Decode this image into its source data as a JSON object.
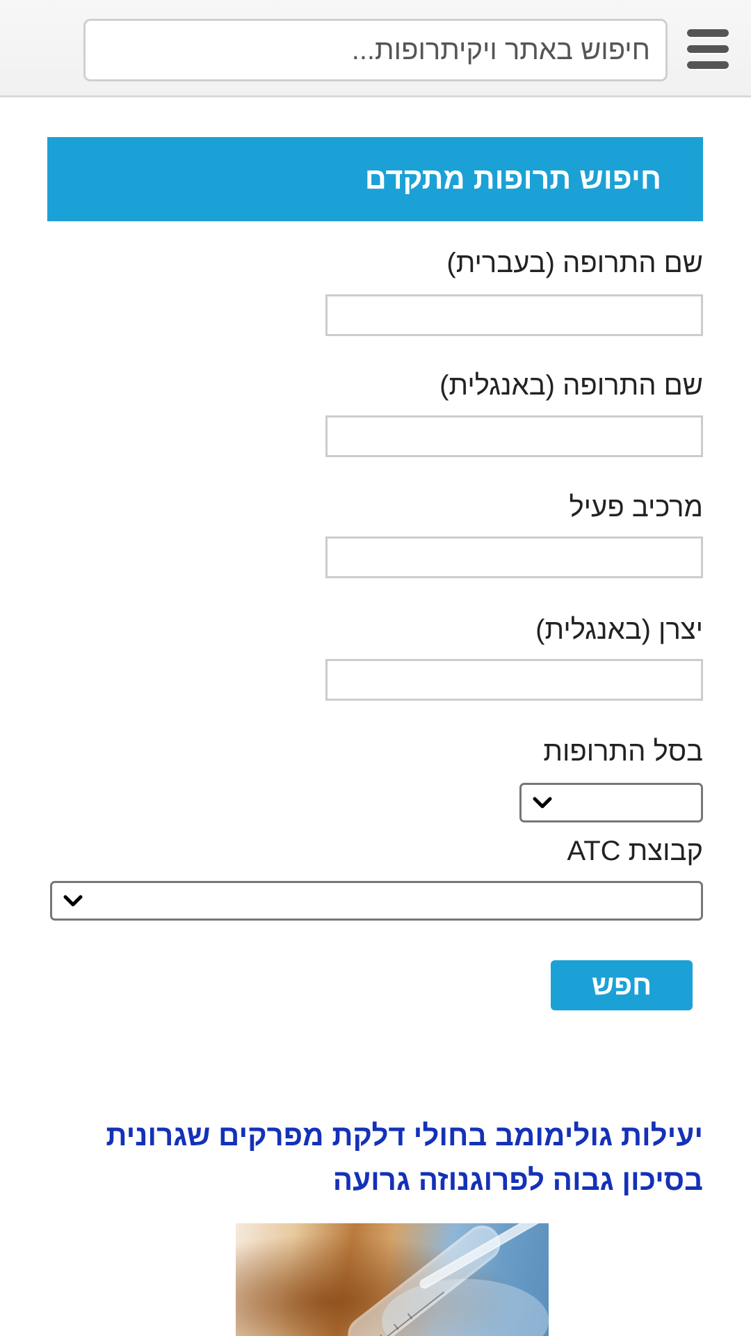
{
  "header": {
    "menu_icon": "hamburger-menu-icon",
    "search_placeholder": "חיפוש באתר ויקיתרופות..."
  },
  "form": {
    "title": "חיפוש תרופות מתקדם",
    "fields": [
      {
        "label": "שם התרופה (בעברית)",
        "value": ""
      },
      {
        "label": "שם התרופה (באנגלית)",
        "value": ""
      },
      {
        "label": "מרכיב פעיל",
        "value": ""
      },
      {
        "label": "יצרן (באנגלית)",
        "value": ""
      }
    ],
    "basket": {
      "label": "בסל התרופות",
      "selected": ""
    },
    "atc": {
      "label": "קבוצת ATC",
      "selected": ""
    },
    "submit_label": "חפש"
  },
  "article": {
    "title": "יעילות גולימומב בחולי דלקת מפרקים שגרונית בסיכון גבוה לפרוגנוזה גרועה",
    "image_icon": "lab-glassware-photo"
  },
  "colors": {
    "accent": "#1ba1d6",
    "link": "#1431b8"
  }
}
